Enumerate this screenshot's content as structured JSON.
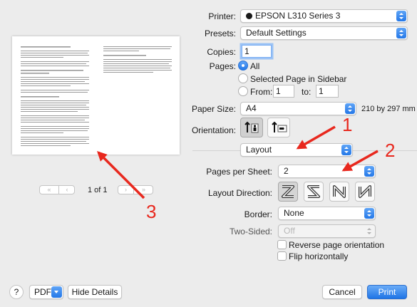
{
  "printer": {
    "label": "Printer:",
    "value": "EPSON L310 Series 3"
  },
  "presets": {
    "label": "Presets:",
    "value": "Default Settings"
  },
  "copies": {
    "label": "Copies:",
    "value": "1"
  },
  "pages": {
    "label": "Pages:",
    "options": [
      "All",
      "Selected Page in Sidebar",
      "From:"
    ],
    "selected": "All",
    "from_value": "1",
    "to_label": "to:",
    "to_value": "1"
  },
  "paper_size": {
    "label": "Paper Size:",
    "value": "A4",
    "dimensions": "210 by 297 mm"
  },
  "orientation": {
    "label": "Orientation:"
  },
  "section": {
    "value": "Layout"
  },
  "pages_per_sheet": {
    "label": "Pages per Sheet:",
    "value": "2"
  },
  "layout_direction": {
    "label": "Layout Direction:"
  },
  "border": {
    "label": "Border:",
    "value": "None"
  },
  "two_sided": {
    "label": "Two-Sided:",
    "value": "Off"
  },
  "checkboxes": {
    "reverse": "Reverse page orientation",
    "flip": "Flip horizontally"
  },
  "preview": {
    "page_indicator": "1 of 1"
  },
  "bottom": {
    "help": "?",
    "pdf": "PDF",
    "hide_details": "Hide Details",
    "cancel": "Cancel",
    "print": "Print"
  },
  "annotations": [
    "1",
    "2",
    "3"
  ],
  "colors": {
    "accent": "#2478e8",
    "annotation": "#e8281e"
  }
}
